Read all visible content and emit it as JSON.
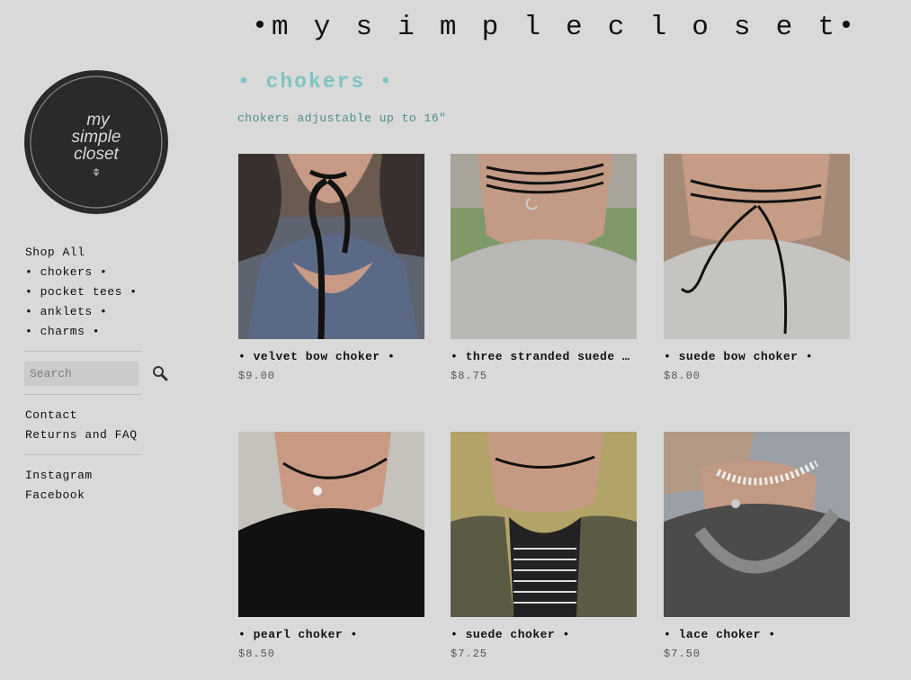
{
  "site": {
    "title_letters": [
      "m",
      "y",
      "s",
      "i",
      "m",
      "p",
      "l",
      "e",
      "c",
      "l",
      "o",
      "s",
      "e",
      "t"
    ],
    "title_dot": "•"
  },
  "logo": {
    "line1": "my",
    "line2": "simple",
    "line3": "closet"
  },
  "nav": {
    "items": [
      {
        "label": "Shop All"
      },
      {
        "label": "• chokers •"
      },
      {
        "label": "• pocket tees •"
      },
      {
        "label": "• anklets •"
      },
      {
        "label": "• charms •"
      }
    ]
  },
  "search": {
    "placeholder": "Search"
  },
  "info_links": [
    {
      "label": "Contact"
    },
    {
      "label": "Returns and FAQ"
    }
  ],
  "social_links": [
    {
      "label": "Instagram"
    },
    {
      "label": "Facebook"
    }
  ],
  "category": {
    "title": "• chokers •",
    "description": "chokers adjustable up to 16\""
  },
  "products": [
    {
      "name": "• velvet bow choker •",
      "price": "$9.00"
    },
    {
      "name": "• three stranded suede choker •",
      "price": "$8.75"
    },
    {
      "name": "• suede bow choker •",
      "price": "$8.00"
    },
    {
      "name": "• pearl choker •",
      "price": "$8.50"
    },
    {
      "name": "• suede choker •",
      "price": "$7.25"
    },
    {
      "name": "• lace choker •",
      "price": "$7.50"
    }
  ],
  "colors": {
    "background": "#d9d9d9",
    "accent": "#7fc4c3",
    "logo_bg": "#2a2a2a"
  }
}
